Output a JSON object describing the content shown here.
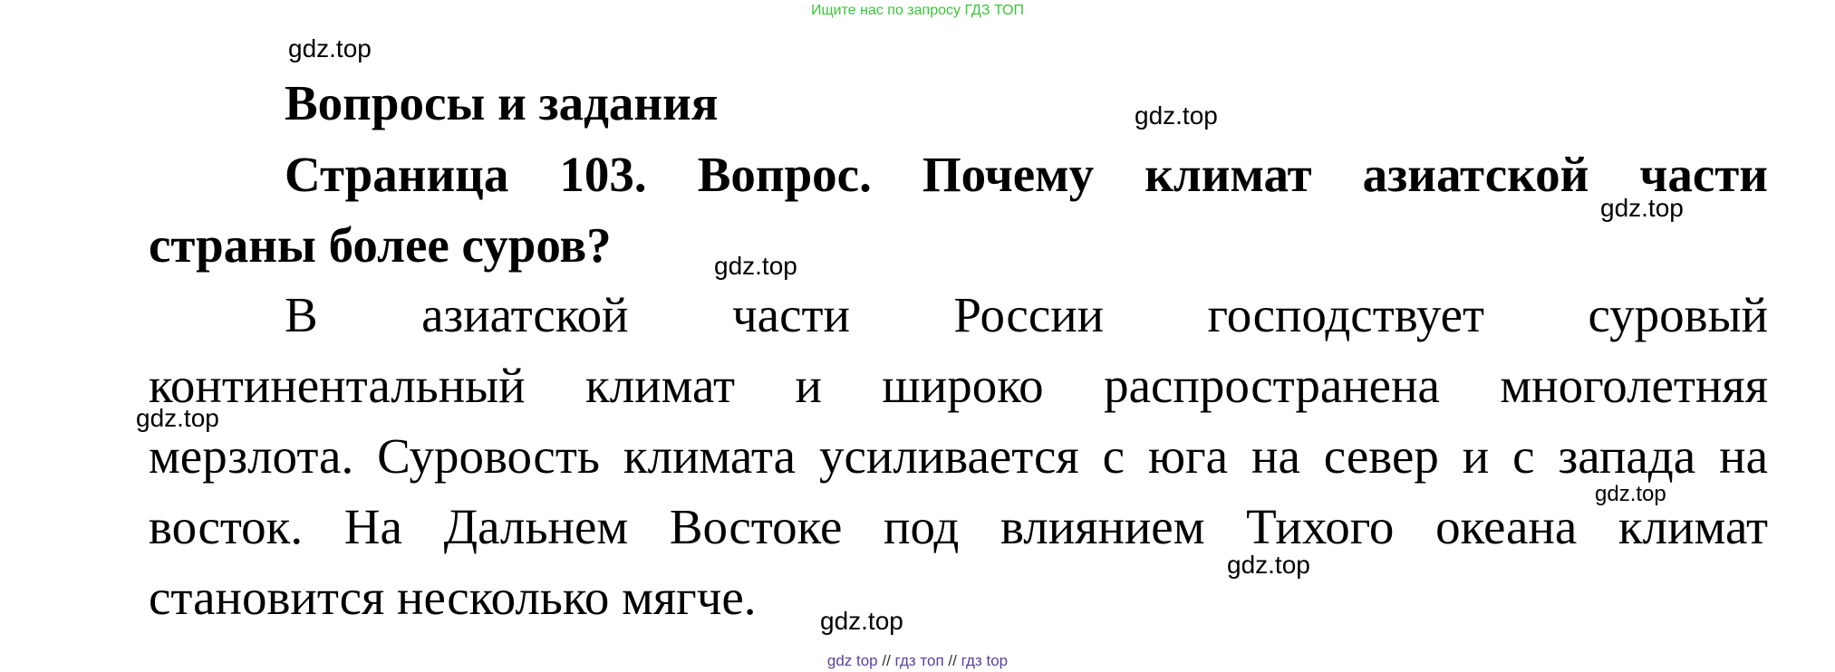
{
  "colors": {
    "banner": "#3cc43c",
    "footer_link": "#5a3fa0",
    "text": "#000000"
  },
  "banner": "Ищите нас по запросу ГДЗ ТОП",
  "watermark": "gdz.top",
  "heading": "Вопросы и задания",
  "question_line1": "Страница 103. Вопрос. Почему климат азиатской части",
  "question_line2": "страны более суров?",
  "answer_lines": [
    "В азиатской части России господствует суровый",
    "континентальный климат и широко распространена многолетняя",
    "мерзлота. Суровость климата усиливается с юга на север и с запада на",
    "восток. На Дальнем Востоке под влиянием Тихого океана климат",
    "становится несколько мягче."
  ],
  "footer": {
    "link1": "gdz top",
    "sep": "//",
    "link2": "гдз топ",
    "link3": "гдз top"
  }
}
